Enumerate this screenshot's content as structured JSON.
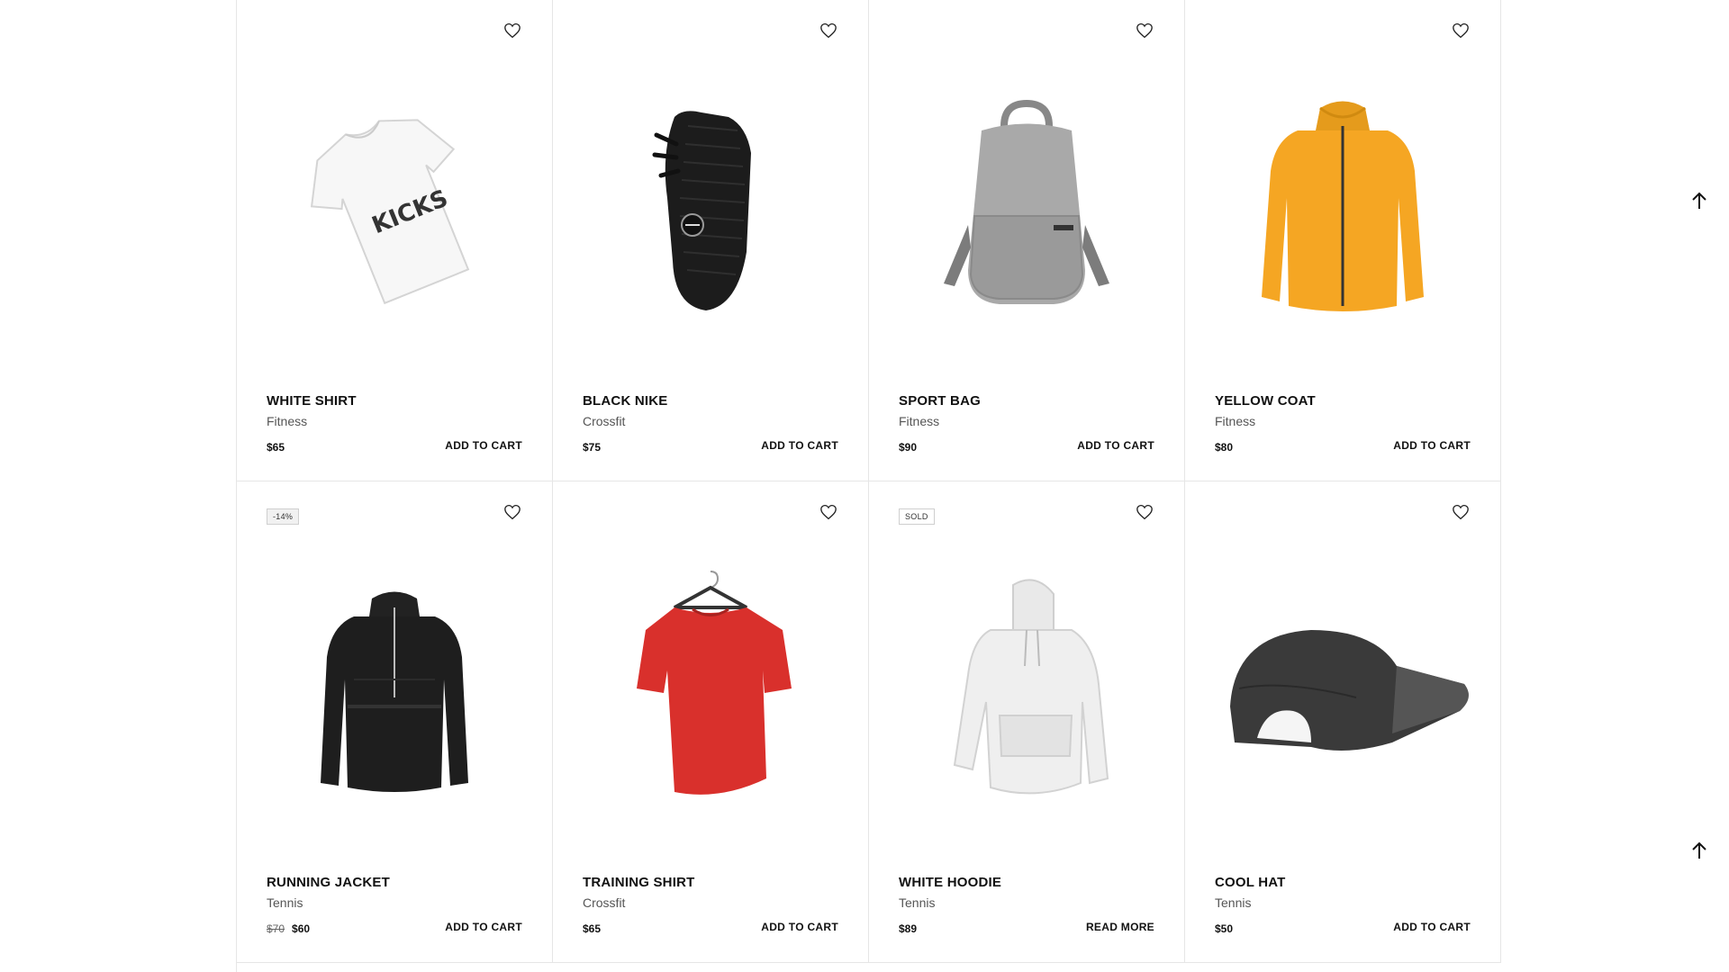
{
  "products": [
    {
      "name": "WHITE SHIRT",
      "category": "Fitness",
      "price": "$65",
      "cta": "ADD TO CART",
      "image": "white-tshirt"
    },
    {
      "name": "BLACK NIKE",
      "category": "Crossfit",
      "price": "$75",
      "cta": "ADD TO CART",
      "image": "black-sneaker"
    },
    {
      "name": "SPORT BAG",
      "category": "Fitness",
      "price": "$90",
      "cta": "ADD TO CART",
      "image": "grey-backpack"
    },
    {
      "name": "YELLOW COAT",
      "category": "Fitness",
      "price": "$80",
      "cta": "ADD TO CART",
      "image": "yellow-jacket"
    },
    {
      "name": "RUNNING JACKET",
      "category": "Tennis",
      "old_price": "$70",
      "price": "$60",
      "badge": "-14%",
      "cta": "ADD TO CART",
      "image": "black-jacket"
    },
    {
      "name": "TRAINING SHIRT",
      "category": "Crossfit",
      "price": "$65",
      "cta": "ADD TO CART",
      "image": "red-tshirt"
    },
    {
      "name": "WHITE HOODIE",
      "category": "Tennis",
      "price": "$89",
      "badge": "SOLD",
      "cta": "READ MORE",
      "image": "white-hoodie"
    },
    {
      "name": "COOL HAT",
      "category": "Tennis",
      "price": "$50",
      "cta": "ADD TO CART",
      "image": "black-cap"
    }
  ],
  "icons": {
    "wishlist": "heart-icon",
    "back_to_top": "arrow-up-icon"
  },
  "colors": {
    "jacket_yellow": "#f5a623",
    "shirt_red": "#d9302c",
    "text": "#111111"
  }
}
